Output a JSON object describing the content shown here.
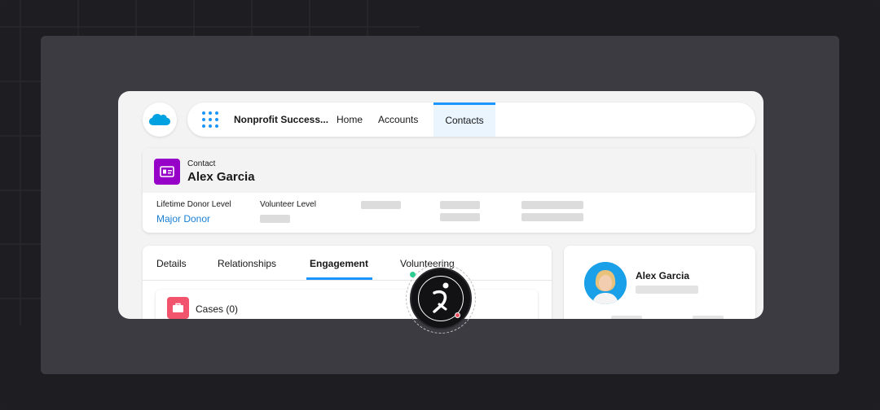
{
  "nav": {
    "app_name": "Nonprofit Success...",
    "items": [
      {
        "label": "Home"
      },
      {
        "label": "Accounts"
      },
      {
        "label": "Contacts",
        "active": true
      }
    ]
  },
  "record": {
    "object_label": "Contact",
    "name": "Alex Garcia",
    "fields": [
      {
        "label": "Lifetime Donor Level",
        "value": "Major Donor"
      },
      {
        "label": "Volunteer Level",
        "value": ""
      }
    ]
  },
  "tabs": {
    "items": [
      {
        "label": "Details"
      },
      {
        "label": "Relationships"
      },
      {
        "label": "Engagement",
        "active": true
      },
      {
        "label": "Volunteering"
      }
    ]
  },
  "cases": {
    "label": "Cases (0)"
  },
  "profile": {
    "name": "Alex Garcia"
  },
  "colors": {
    "accent": "#1b96ff",
    "contact_icon": "#9602c7",
    "cases_icon": "#f2536d",
    "link": "#1a7fd4"
  },
  "icons": {
    "logo": "salesforce-cloud-icon",
    "launcher": "app-launcher-grid-icon",
    "contact": "contact-card-icon",
    "cases": "briefcase-icon",
    "assistant": "assistant-figure-icon"
  }
}
